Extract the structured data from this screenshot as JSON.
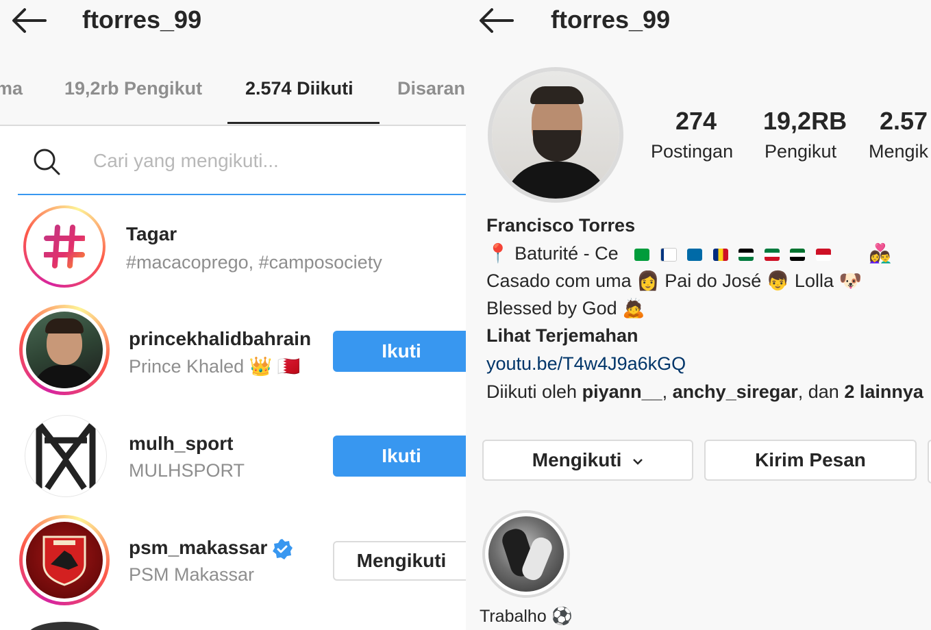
{
  "left": {
    "username": "ftorres_99",
    "tabs": [
      {
        "label": "ma"
      },
      {
        "label": "19,2rb Pengikut"
      },
      {
        "label": "2.574 Diikuti"
      },
      {
        "label": "Disaran"
      }
    ],
    "search": {
      "placeholder": "Cari yang mengikuti..."
    },
    "list": [
      {
        "name": "Tagar",
        "sub": "#macacoprego, #camposociety",
        "icon": "hashtag-icon"
      },
      {
        "name": "princekhalidbahrain",
        "sub": "Prince Khaled 👑 🇧🇭",
        "button": "Ikuti"
      },
      {
        "name": "mulh_sport",
        "sub": "MULHSPORT",
        "button": "Ikuti"
      },
      {
        "name": "psm_makassar",
        "sub": "PSM Makassar",
        "button": "Mengikuti",
        "verified": true
      }
    ]
  },
  "right": {
    "username": "ftorres_99",
    "stats": [
      {
        "num": "274",
        "label": "Postingan"
      },
      {
        "num": "19,2RB",
        "label": "Pengikut"
      },
      {
        "num": "2.57",
        "label": "Mengik"
      }
    ],
    "bio": {
      "name": "Francisco Torres",
      "line1": "📍 Baturité - Ce",
      "line2": "Casado com uma 👩 Pai do José 👦 Lolla 🐶",
      "line3": "Blessed by God 🙇",
      "translate": "Lihat Terjemahan",
      "link": "youtu.be/T4w4J9a6kGQ",
      "followed_prefix": "Diikuti oleh",
      "followed_user1": "piyann__",
      "followed_sep": ",",
      "followed_user2": "anchy_siregar",
      "followed_and": ", dan",
      "followed_more": "2 lainnya"
    },
    "buttons": {
      "following": "Mengikuti",
      "message": "Kirim Pesan"
    },
    "highlight": {
      "label": "Trabalho ⚽"
    }
  },
  "colors": {
    "accent": "#3897f0",
    "text": "#262626",
    "muted": "#8e8e8e",
    "link": "#003569"
  }
}
